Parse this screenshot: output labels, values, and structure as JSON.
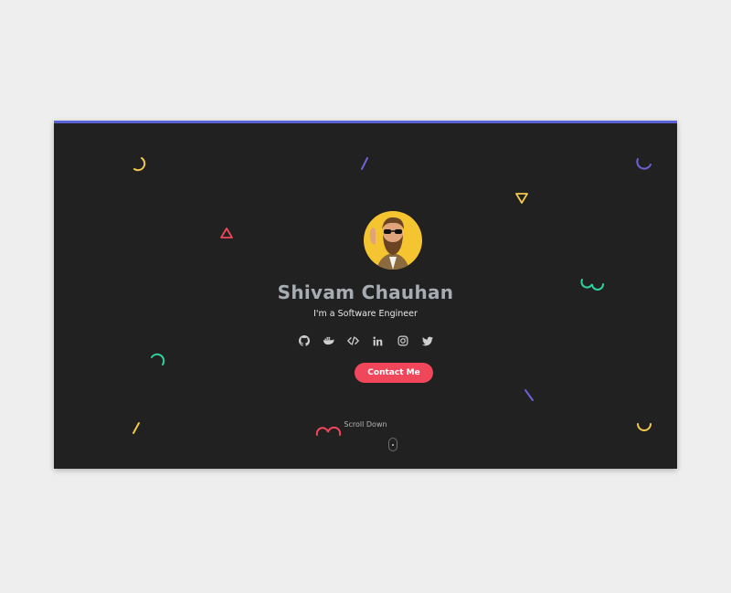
{
  "profile": {
    "name": "Shivam Chauhan",
    "tagline": "I'm a Software Engineer",
    "avatar_icon": "bearded-man-avatar-icon"
  },
  "socials": [
    {
      "icon": "github-icon"
    },
    {
      "icon": "docker-icon"
    },
    {
      "icon": "code-icon"
    },
    {
      "icon": "linkedin-icon"
    },
    {
      "icon": "instagram-icon"
    },
    {
      "icon": "twitter-icon"
    }
  ],
  "cta": {
    "label": "Contact Me"
  },
  "scroll": {
    "label": "Scroll Down"
  },
  "colors": {
    "background": "#212121",
    "accent_border": "#5a63d6",
    "button": "#f0475b",
    "avatar_bg": "#f4c531",
    "shape_yellow": "#f2c94c",
    "shape_purple": "#6c63d8",
    "shape_red": "#f0475b",
    "shape_teal": "#2ed3a0"
  }
}
